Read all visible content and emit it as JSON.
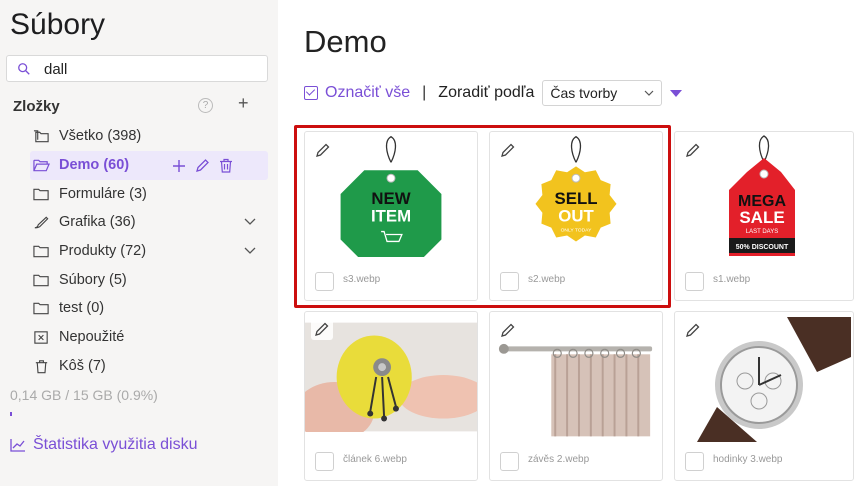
{
  "sidebar": {
    "title": "Súbory",
    "search_value": "dall",
    "folders_label": "Zložky",
    "help_glyph": "?",
    "add_glyph": "+",
    "items": [
      {
        "label": "Všetko",
        "count": "(398)"
      },
      {
        "label": "Demo",
        "count": "(60)"
      },
      {
        "label": "Formuláre",
        "count": "(3)"
      },
      {
        "label": "Grafika",
        "count": "(36)"
      },
      {
        "label": "Produkty",
        "count": "(72)"
      },
      {
        "label": "Súbory",
        "count": "(5)"
      },
      {
        "label": "test",
        "count": "(0)"
      },
      {
        "label": "Nepoužité",
        "count": ""
      },
      {
        "label": "Kôš",
        "count": "(7)"
      }
    ],
    "usage_text": "0,14 GB / 15 GB (0.9%)",
    "usage_fraction": 0.009,
    "stats_link": "Štatistika využitia disku"
  },
  "main": {
    "title": "Demo",
    "select_all": "Označiť vše",
    "separator": "|",
    "sort_label": "Zoradiť podľa",
    "sort_value": "Čas tvorby",
    "files": [
      {
        "name": "s3.webp",
        "tag_line1": "NEW",
        "tag_line2": "ITEM"
      },
      {
        "name": "s2.webp",
        "tag_line1": "SELL",
        "tag_line2": "OUT",
        "tag_small": "ONLY TODAY"
      },
      {
        "name": "s1.webp",
        "tag_line1": "MEGA",
        "tag_line2": "SALE",
        "tag_small": "LAST DAYS",
        "tag_bottom": "50% DISCOUNT"
      },
      {
        "name": "článek 6.webp"
      },
      {
        "name": "závěs 2.webp"
      },
      {
        "name": "hodinky 3.webp"
      }
    ]
  },
  "colors": {
    "accent": "#7a4fd6",
    "highlight": "#cc0e0e",
    "sidebar_bg": "#f6f5f4"
  }
}
